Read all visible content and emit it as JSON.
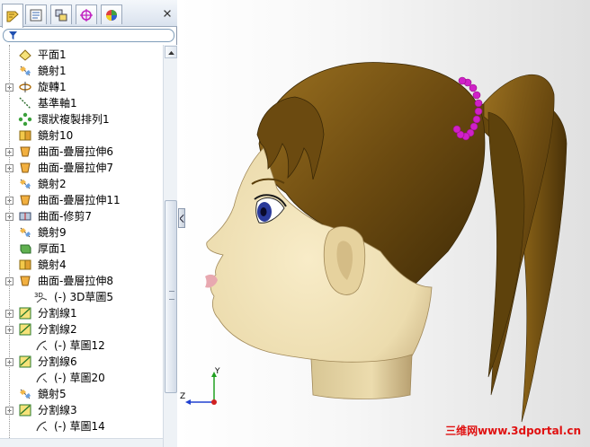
{
  "panel": {
    "tabs": [
      {
        "name": "feature-manager-tab"
      },
      {
        "name": "property-manager-tab"
      },
      {
        "name": "configuration-manager-tab"
      },
      {
        "name": "dimxpert-manager-tab"
      },
      {
        "name": "appearance-manager-tab"
      }
    ],
    "close_glyph": "×"
  },
  "tree": {
    "items": [
      {
        "label": "平面1",
        "icon": "plane-icon",
        "expandable": false
      },
      {
        "label": "鏡射1",
        "icon": "mirror-icon",
        "expandable": false
      },
      {
        "label": "旋轉1",
        "icon": "revolve-icon",
        "expandable": true
      },
      {
        "label": "基準軸1",
        "icon": "axis-icon",
        "expandable": false
      },
      {
        "label": "環狀複製排列1",
        "icon": "circular-pattern-icon",
        "expandable": false
      },
      {
        "label": "鏡射10",
        "icon": "mirror-body-icon",
        "expandable": false
      },
      {
        "label": "曲面-疊層拉伸6",
        "icon": "loft-surface-icon",
        "expandable": true
      },
      {
        "label": "曲面-疊層拉伸7",
        "icon": "loft-surface-icon",
        "expandable": true
      },
      {
        "label": "鏡射2",
        "icon": "mirror-icon",
        "expandable": false
      },
      {
        "label": "曲面-疊層拉伸11",
        "icon": "loft-surface-icon",
        "expandable": true
      },
      {
        "label": "曲面-修剪7",
        "icon": "trim-surface-icon",
        "expandable": true
      },
      {
        "label": "鏡射9",
        "icon": "mirror-icon",
        "expandable": false
      },
      {
        "label": "厚面1",
        "icon": "thicken-icon",
        "expandable": false
      },
      {
        "label": "鏡射4",
        "icon": "mirror-body-icon",
        "expandable": false
      },
      {
        "label": "曲面-疊層拉伸8",
        "icon": "loft-surface-icon",
        "expandable": true
      },
      {
        "label": "(-) 3D草圖5",
        "icon": "3d-sketch-icon",
        "expandable": false,
        "child": true
      },
      {
        "label": "分割線1",
        "icon": "split-line-icon",
        "expandable": true
      },
      {
        "label": "分割線2",
        "icon": "split-line-icon",
        "expandable": true
      },
      {
        "label": "(-) 草圖12",
        "icon": "sketch-icon",
        "expandable": false,
        "child": true
      },
      {
        "label": "分割線6",
        "icon": "split-line-icon",
        "expandable": true
      },
      {
        "label": "(-) 草圖20",
        "icon": "sketch-icon",
        "expandable": false,
        "child": true
      },
      {
        "label": "鏡射5",
        "icon": "mirror-icon",
        "expandable": false
      },
      {
        "label": "分割線3",
        "icon": "split-line-icon",
        "expandable": true
      },
      {
        "label": "(-) 草圖14",
        "icon": "sketch-icon",
        "expandable": false,
        "child": true
      }
    ]
  },
  "viewport": {
    "triad": {
      "x_label": "Z",
      "y_label": "Y"
    },
    "watermark": "三维网www.3dportal.cn"
  },
  "colors": {
    "hair": "#6b4a10",
    "skin": "#ecdcae",
    "hair_tie": "#d020c8",
    "eye": "#2a3a9a",
    "lips": "#e8a8b0",
    "panel_border": "#8a98ad"
  }
}
